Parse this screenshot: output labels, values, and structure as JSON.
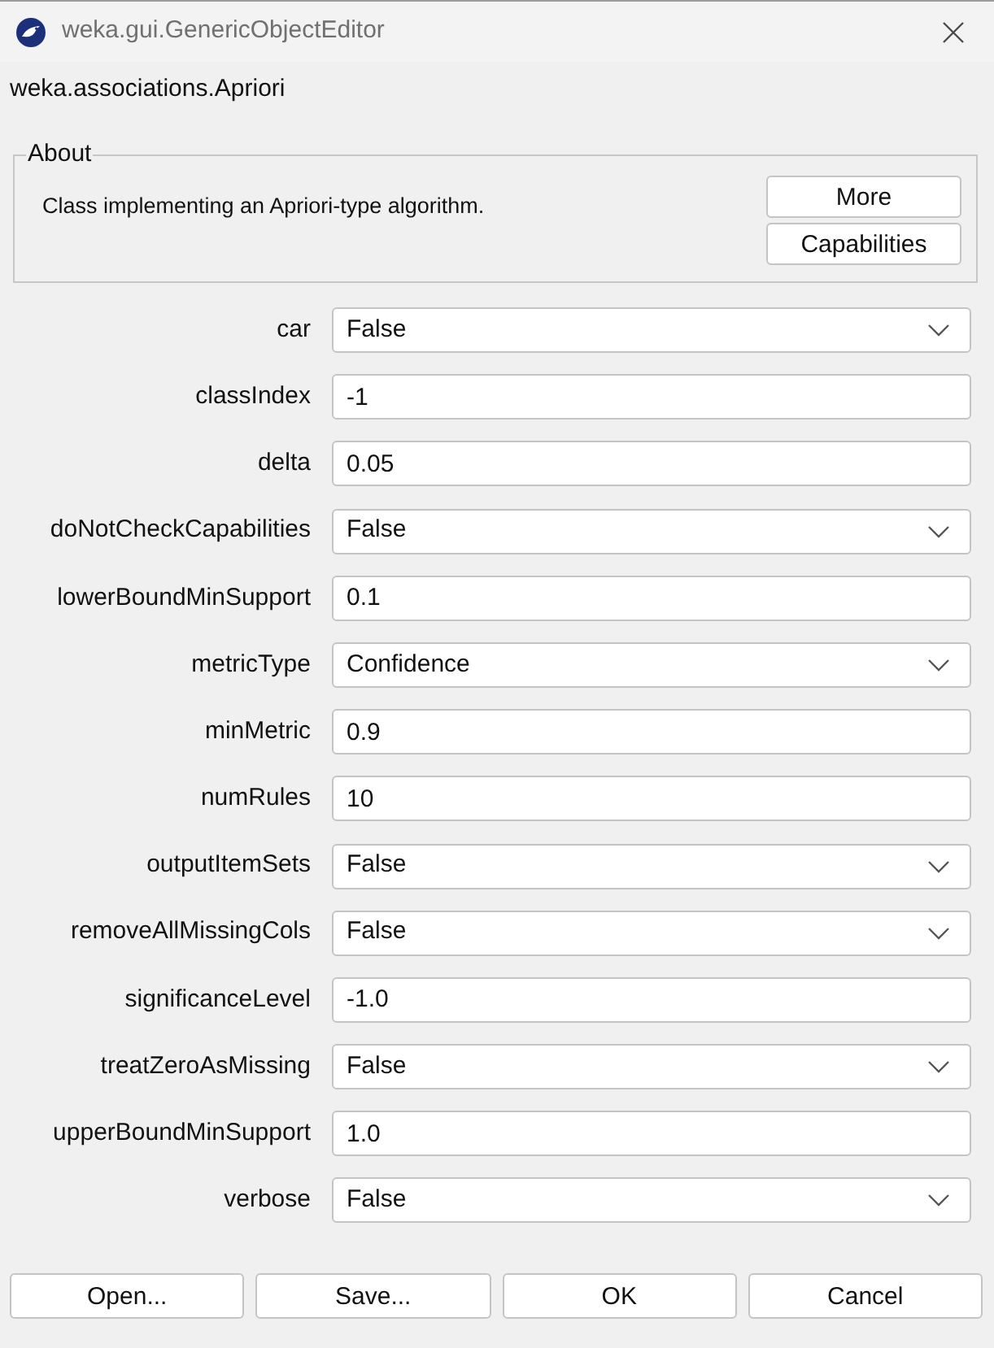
{
  "window": {
    "title": "weka.gui.GenericObjectEditor"
  },
  "class_name": "weka.associations.Apriori",
  "about": {
    "legend": "About",
    "description": "Class implementing an Apriori-type algorithm.",
    "buttons": [
      "More",
      "Capabilities"
    ]
  },
  "properties": [
    {
      "label": "car",
      "kind": "dropdown",
      "value": "False"
    },
    {
      "label": "classIndex",
      "kind": "text",
      "value": "-1"
    },
    {
      "label": "delta",
      "kind": "text",
      "value": "0.05"
    },
    {
      "label": "doNotCheckCapabilities",
      "kind": "dropdown",
      "value": "False"
    },
    {
      "label": "lowerBoundMinSupport",
      "kind": "text",
      "value": "0.1"
    },
    {
      "label": "metricType",
      "kind": "dropdown",
      "value": "Confidence"
    },
    {
      "label": "minMetric",
      "kind": "text",
      "value": "0.9"
    },
    {
      "label": "numRules",
      "kind": "text",
      "value": "10"
    },
    {
      "label": "outputItemSets",
      "kind": "dropdown",
      "value": "False"
    },
    {
      "label": "removeAllMissingCols",
      "kind": "dropdown",
      "value": "False"
    },
    {
      "label": "significanceLevel",
      "kind": "text",
      "value": "-1.0"
    },
    {
      "label": "treatZeroAsMissing",
      "kind": "dropdown",
      "value": "False"
    },
    {
      "label": "upperBoundMinSupport",
      "kind": "text",
      "value": "1.0"
    },
    {
      "label": "verbose",
      "kind": "dropdown",
      "value": "False"
    }
  ],
  "buttons": [
    "Open...",
    "Save...",
    "OK",
    "Cancel"
  ]
}
